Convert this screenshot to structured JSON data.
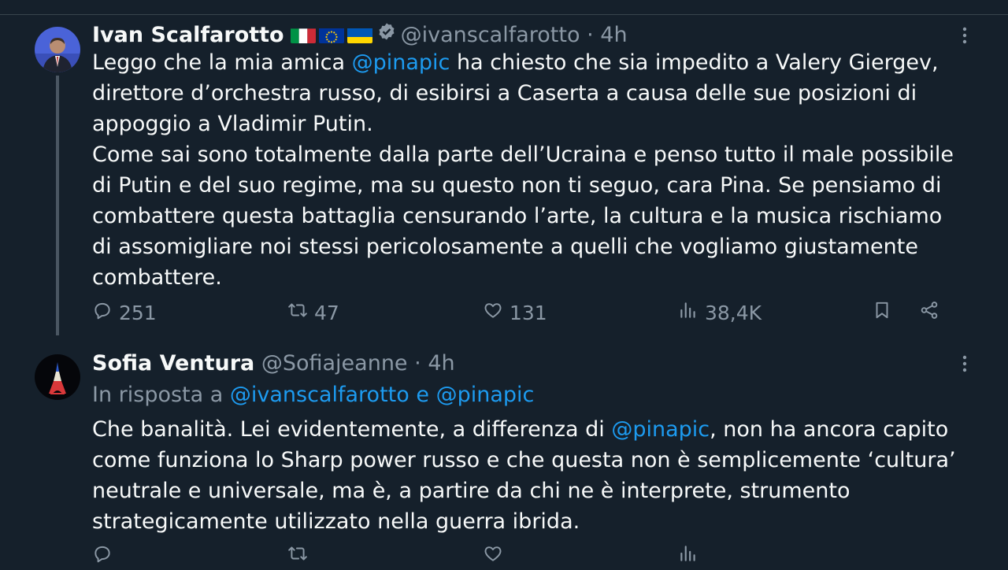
{
  "tweets": [
    {
      "name": "Ivan Scalfarotto",
      "handle": "@ivanscalfarotto",
      "separator": "·",
      "time": "4h",
      "flags": [
        "italy-flag-icon",
        "eu-flag-icon",
        "ukraine-flag-icon"
      ],
      "verified": true,
      "paragraphs": [
        [
          {
            "t": "Leggo che la mia amica "
          },
          {
            "t": "@pinapic",
            "mention": true
          },
          {
            "t": " ha chiesto che sia impedito a Valery Giergev, direttore d’orchestra russo, di esibirsi a Caserta a causa delle sue posizioni di appoggio a Vladimir Putin."
          }
        ],
        [
          {
            "t": "Come sai sono totalmente dalla parte dell’Ucraina e penso tutto il male possibile di Putin e del suo regime, ma su questo non ti seguo, cara Pina. Se pensiamo  di combattere questa battaglia censurando l’arte, la cultura e la musica rischiamo di assomigliare noi stessi pericolosamente a quelli che vogliamo giustamente combattere."
          }
        ]
      ],
      "actions": {
        "replies": "251",
        "retweets": "47",
        "likes": "131",
        "views": "38,4K"
      }
    },
    {
      "name": "Sofia Ventura",
      "handle": "@Sofiajeanne",
      "separator": "·",
      "time": "4h",
      "reply_prefix": "In risposta a",
      "reply_handles": [
        "@ivanscalfarotto",
        "@pinapic"
      ],
      "reply_joiner": "e",
      "paragraphs": [
        [
          {
            "t": "Che banalità. Lei evidentemente, a differenza di "
          },
          {
            "t": "@pinapic",
            "mention": true
          },
          {
            "t": ", non ha ancora capito come funziona lo Sharp power russo e che questa non è semplicemente ‘cultura’ neutrale e universale, ma è, a partire da chi ne è interprete, strumento strategicamente utilizzato nella guerra ibrida."
          }
        ]
      ],
      "actions": {
        "replies": "",
        "retweets": "",
        "likes": "",
        "views": ""
      }
    }
  ],
  "icons": {
    "more": "more-options-icon",
    "reply": "reply-icon",
    "retweet": "retweet-icon",
    "like": "heart-icon",
    "views": "views-icon",
    "bookmark": "bookmark-icon",
    "share": "share-icon"
  },
  "colors": {
    "background": "#15202b",
    "text": "#f7f9f9",
    "secondary": "#8b98a5",
    "accent": "#1d9bf0"
  }
}
